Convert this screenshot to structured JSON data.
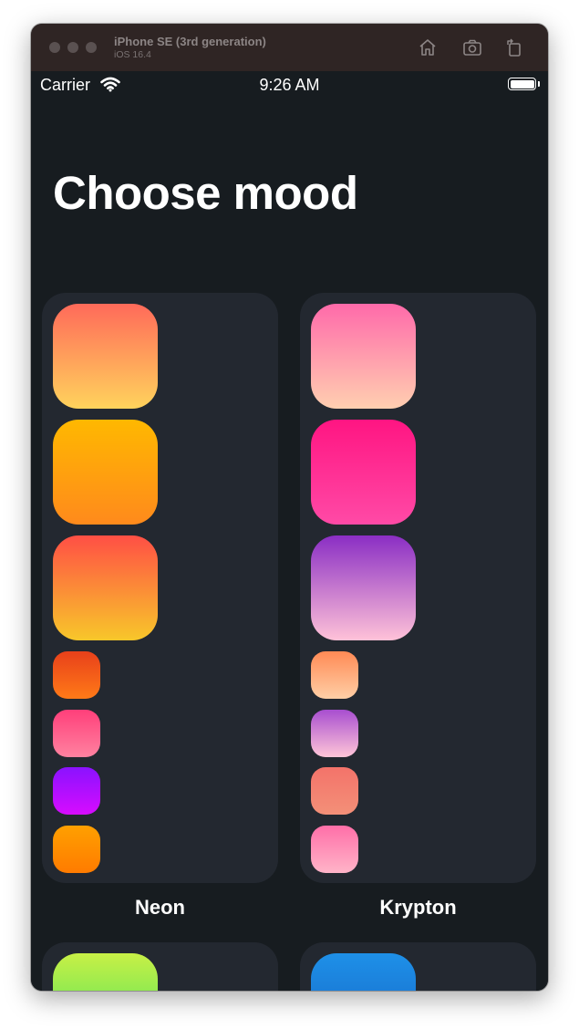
{
  "window": {
    "device_name": "iPhone SE (3rd generation)",
    "os_version": "iOS 16.4",
    "toolbar_icons": [
      "home-icon",
      "screenshot-icon",
      "rotate-icon"
    ]
  },
  "status_bar": {
    "carrier": "Carrier",
    "time": "9:26 AM",
    "icons": [
      "wifi-icon",
      "battery-icon"
    ]
  },
  "page": {
    "title": "Choose mood"
  },
  "moods": [
    {
      "name": "Neon",
      "large_swatches": [
        {
          "top": "#ff6a5a",
          "bottom": "#ffd35c"
        },
        {
          "top": "#ffb800",
          "bottom": "#ff8a1c"
        },
        {
          "top": "#ff4f45",
          "bottom": "#f8c72a"
        }
      ],
      "small_swatches": [
        {
          "top": "#e8401a",
          "bottom": "#ff7a18"
        },
        {
          "top": "#ff3f7a",
          "bottom": "#ff82a0"
        },
        {
          "top": "#8a12ff",
          "bottom": "#d70cff"
        },
        {
          "top": "#ffa000",
          "bottom": "#ff7b00"
        }
      ]
    },
    {
      "name": "Krypton",
      "large_swatches": [
        {
          "top": "#ff6aaa",
          "bottom": "#ffcfb0"
        },
        {
          "top": "#ff1582",
          "bottom": "#ff4aa6"
        },
        {
          "top": "#8a2ec4",
          "bottom": "#ffc2d8"
        }
      ],
      "small_swatches": [
        {
          "top": "#ff8a55",
          "bottom": "#ffcfa6"
        },
        {
          "top": "#a84ed0",
          "bottom": "#ffc6d8"
        },
        {
          "top": "#f3736a",
          "bottom": "#f39078"
        },
        {
          "top": "#ff6fa8",
          "bottom": "#ffb4c8"
        }
      ]
    },
    {
      "name": "",
      "large_swatches": [
        {
          "top": "#c8f046",
          "bottom": "#38e060"
        }
      ],
      "small_swatches": []
    },
    {
      "name": "",
      "large_swatches": [
        {
          "top": "#1e90e8",
          "bottom": "#1560c0"
        }
      ],
      "small_swatches": []
    }
  ]
}
